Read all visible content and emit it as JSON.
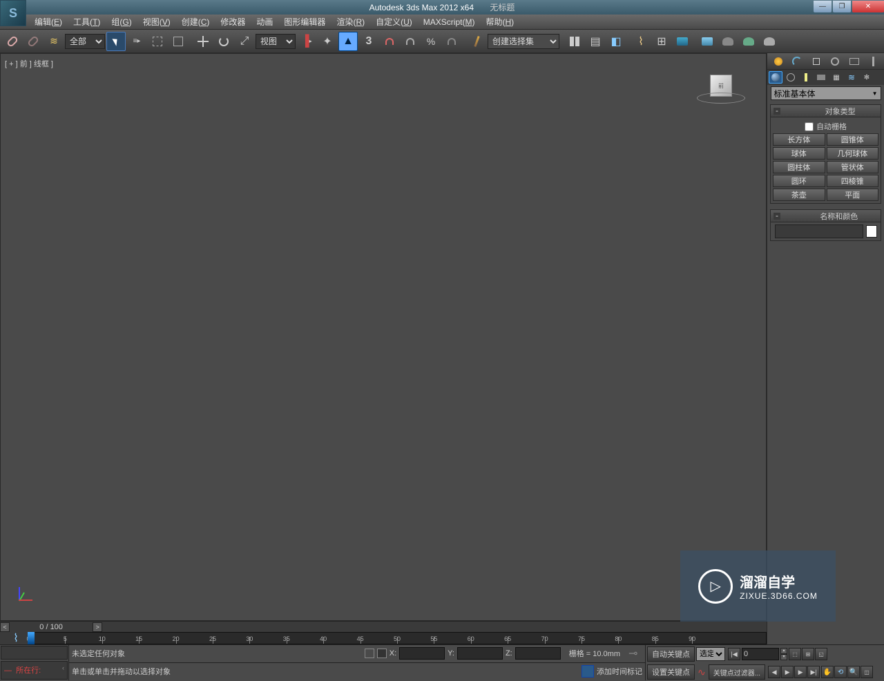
{
  "title": {
    "app": "Autodesk 3ds Max  2012 x64",
    "doc": "无标题"
  },
  "menus": [
    {
      "label": "编辑",
      "u": "E"
    },
    {
      "label": "工具",
      "u": "T"
    },
    {
      "label": "组",
      "u": "G"
    },
    {
      "label": "视图",
      "u": "V"
    },
    {
      "label": "创建",
      "u": "C"
    },
    {
      "label": "修改器",
      "u": ""
    },
    {
      "label": "动画",
      "u": ""
    },
    {
      "label": "图形编辑器",
      "u": ""
    },
    {
      "label": "渲染",
      "u": "R"
    },
    {
      "label": "自定义",
      "u": "U"
    },
    {
      "label": "MAXScript",
      "u": "M"
    },
    {
      "label": "帮助",
      "u": "H"
    }
  ],
  "toolbar": {
    "filter_all": "全部",
    "ref_coord": "视图",
    "named_sel": "创建选择集"
  },
  "viewport": {
    "label": "[ + ] 前 ] 线框  ]",
    "cube": "前"
  },
  "command_panel": {
    "category": "标准基本体",
    "rollout_object_type": "对象类型",
    "autogrid": "自动栅格",
    "primitives": [
      [
        "长方体",
        "圆锥体"
      ],
      [
        "球体",
        "几何球体"
      ],
      [
        "圆柱体",
        "管状体"
      ],
      [
        "圆环",
        "四棱锥"
      ],
      [
        "茶壶",
        "平面"
      ]
    ],
    "rollout_name_color": "名称和颜色"
  },
  "timeline": {
    "frame_display": "0 / 100",
    "ticks": [
      0,
      5,
      10,
      15,
      20,
      25,
      30,
      35,
      40,
      45,
      50,
      55,
      60,
      65,
      70,
      75,
      80,
      85,
      90
    ]
  },
  "status": {
    "prompt_label": "所在行:",
    "no_selection": "未选定任何对象",
    "hint": "单击或单击并拖动以选择对象",
    "x": "X:",
    "y": "Y:",
    "z": "Z:",
    "grid": "栅格 = 10.0mm",
    "add_time_tag": "添加时间标记",
    "auto_key": "自动关键点",
    "sel_key": "选定对",
    "set_key": "设置关键点",
    "key_filters": "关键点过滤器...",
    "frame": "0"
  },
  "watermark": {
    "brand": "溜溜自学",
    "url": "ZIXUE.3D66.COM"
  }
}
